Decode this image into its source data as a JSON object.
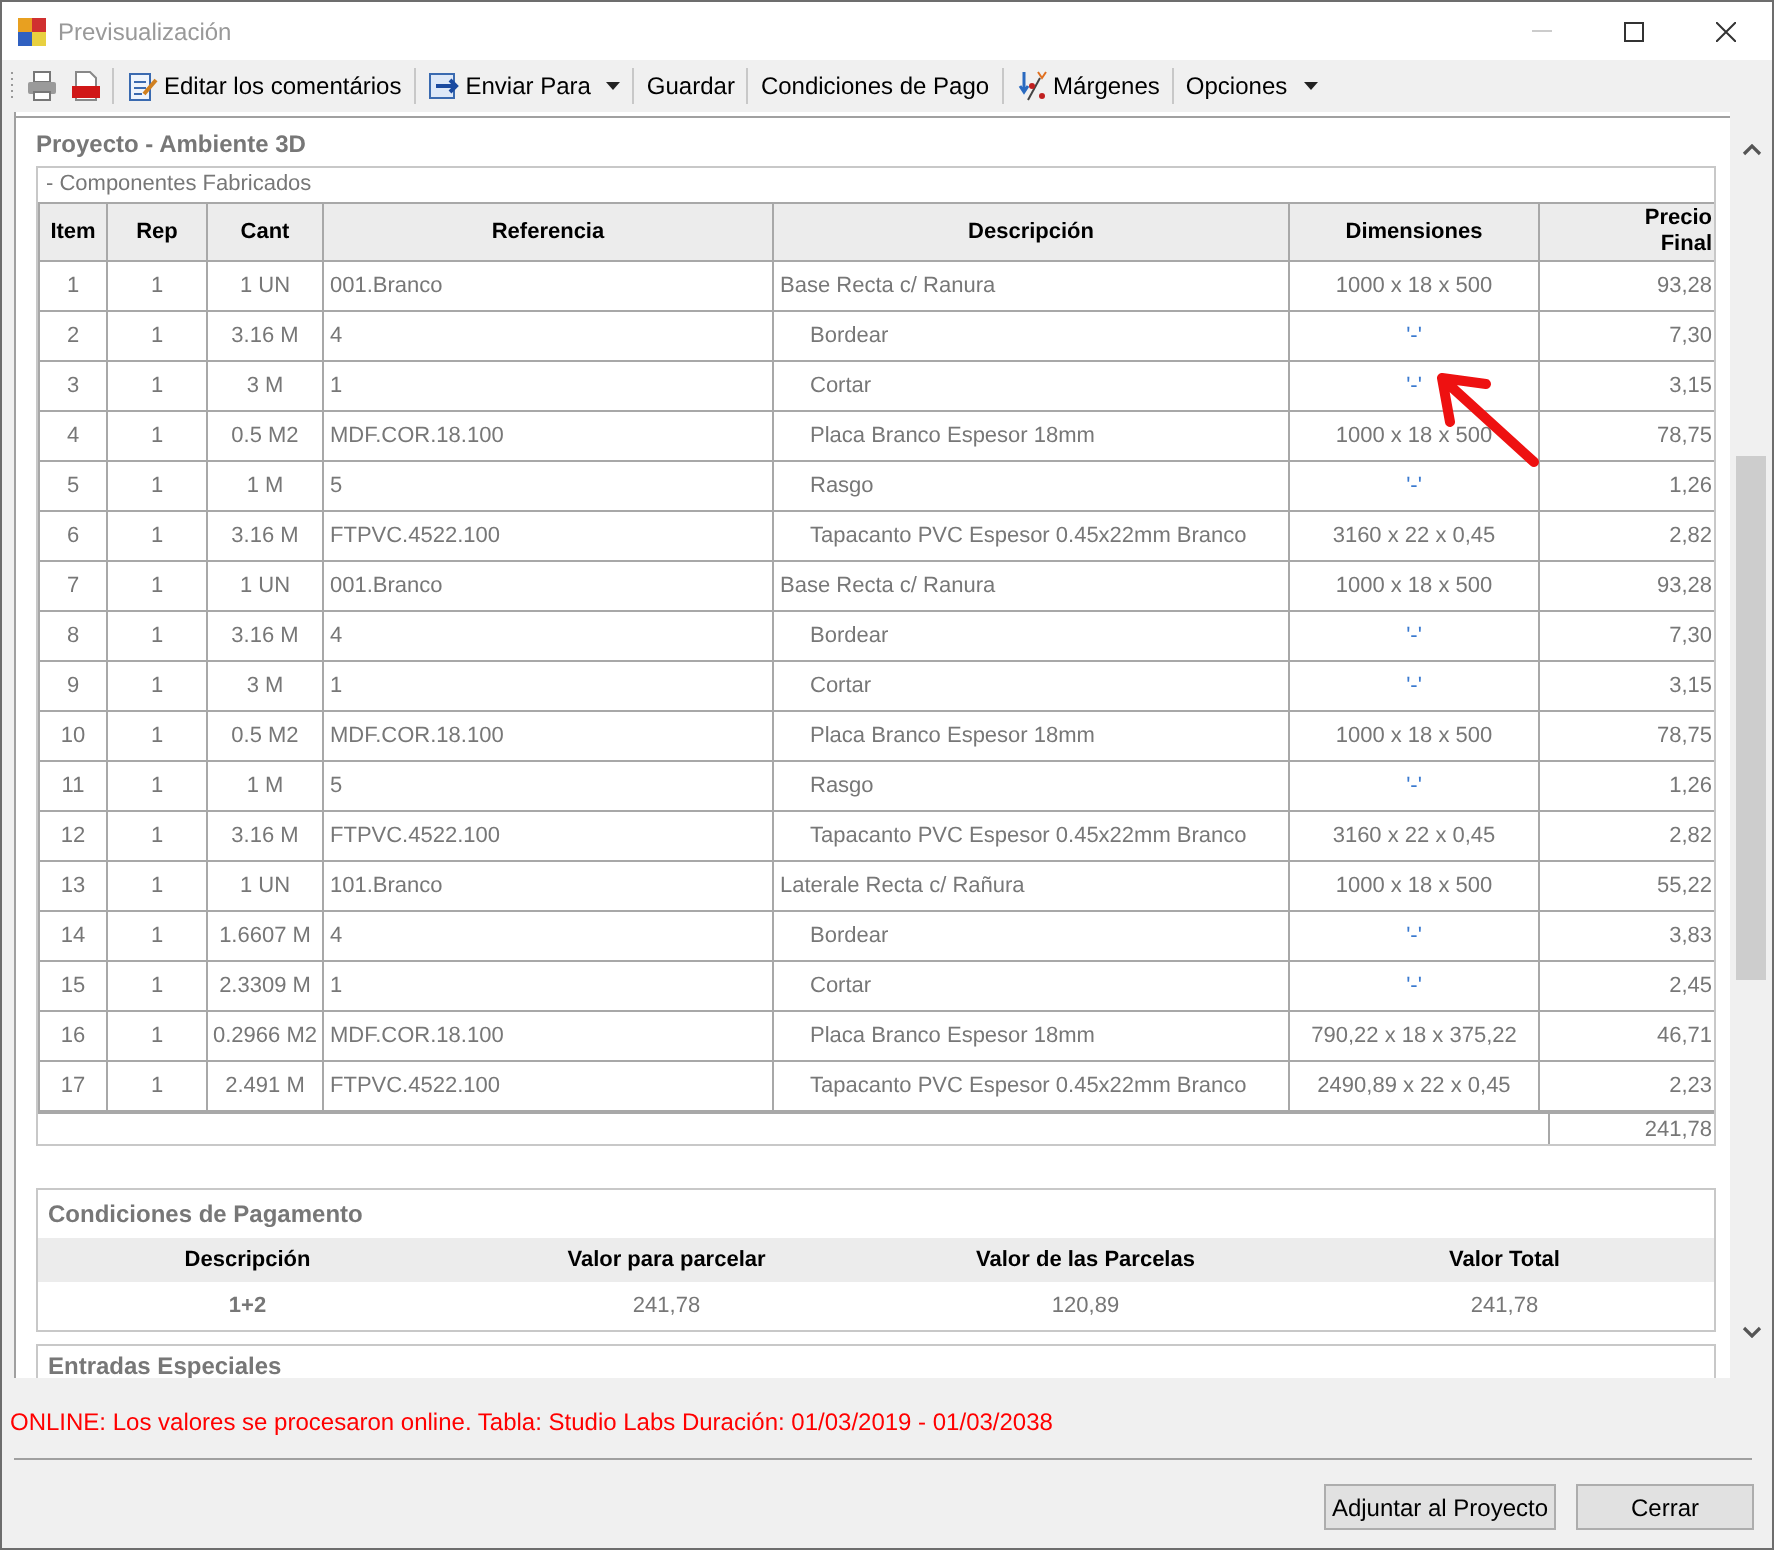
{
  "window": {
    "title": "Previsualización"
  },
  "toolbar": [
    {
      "kind": "icon"
    },
    {
      "kind": "icon"
    },
    {
      "kind": "sep"
    },
    {
      "kind": "button",
      "label": "Editar los comentários"
    },
    {
      "kind": "sep"
    },
    {
      "kind": "dropdown",
      "label": "Enviar Para"
    },
    {
      "kind": "sep"
    },
    {
      "kind": "button",
      "label": "Guardar"
    },
    {
      "kind": "sep"
    },
    {
      "kind": "button",
      "label": "Condiciones de Pago"
    },
    {
      "kind": "sep"
    },
    {
      "kind": "button",
      "label": "Márgenes"
    },
    {
      "kind": "sep"
    },
    {
      "kind": "dropdown",
      "label": "Opciones"
    }
  ],
  "report": {
    "title": "Proyecto - Ambiente 3D",
    "section": "- Componentes Fabricados",
    "columns": [
      "Item",
      "Rep",
      "Cant",
      "Referencia",
      "Descripción",
      "Dimensiones",
      "Precio Final"
    ],
    "rows": [
      {
        "kind": "component",
        "cells": [
          "1",
          "1",
          "1 UN",
          "001.Branco",
          "Base Recta c/ Ranura",
          "1000 x 18 x 500",
          "93,28"
        ]
      },
      {
        "kind": "part",
        "cells": [
          "2",
          "1",
          "3.16 M",
          "4",
          "Bordear",
          "'-'",
          "7,30"
        ]
      },
      {
        "kind": "part",
        "cells": [
          "3",
          "1",
          "3 M",
          "1",
          "Cortar",
          "'-'",
          "3,15"
        ]
      },
      {
        "kind": "part",
        "cells": [
          "4",
          "1",
          "0.5 M2",
          "MDF.COR.18.100",
          "Placa Branco Espesor 18mm",
          "1000 x 18 x 500",
          "78,75"
        ]
      },
      {
        "kind": "part",
        "cells": [
          "5",
          "1",
          "1 M",
          "5",
          "Rasgo",
          "'-'",
          "1,26"
        ]
      },
      {
        "kind": "part",
        "cells": [
          "6",
          "1",
          "3.16 M",
          "FTPVC.4522.100",
          "Tapacanto PVC Espesor 0.45x22mm Branco",
          "3160 x 22 x 0,45",
          "2,82"
        ]
      },
      {
        "kind": "component",
        "cells": [
          "7",
          "1",
          "1 UN",
          "001.Branco",
          "Base Recta c/ Ranura",
          "1000 x 18 x 500",
          "93,28"
        ]
      },
      {
        "kind": "part",
        "cells": [
          "8",
          "1",
          "3.16 M",
          "4",
          "Bordear",
          "'-'",
          "7,30"
        ]
      },
      {
        "kind": "part",
        "cells": [
          "9",
          "1",
          "3 M",
          "1",
          "Cortar",
          "'-'",
          "3,15"
        ]
      },
      {
        "kind": "part",
        "cells": [
          "10",
          "1",
          "0.5 M2",
          "MDF.COR.18.100",
          "Placa Branco Espesor 18mm",
          "1000 x 18 x 500",
          "78,75"
        ]
      },
      {
        "kind": "part",
        "cells": [
          "11",
          "1",
          "1 M",
          "5",
          "Rasgo",
          "'-'",
          "1,26"
        ]
      },
      {
        "kind": "part",
        "cells": [
          "12",
          "1",
          "3.16 M",
          "FTPVC.4522.100",
          "Tapacanto PVC Espesor 0.45x22mm Branco",
          "3160 x 22 x 0,45",
          "2,82"
        ]
      },
      {
        "kind": "component",
        "cells": [
          "13",
          "1",
          "1 UN",
          "101.Branco",
          "Laterale Recta c/ Rañura",
          "1000 x 18 x 500",
          "55,22"
        ]
      },
      {
        "kind": "part",
        "cells": [
          "14",
          "1",
          "1.6607 M",
          "4",
          "Bordear",
          "'-'",
          "3,83"
        ]
      },
      {
        "kind": "part",
        "cells": [
          "15",
          "1",
          "2.3309 M",
          "1",
          "Cortar",
          "'-'",
          "2,45"
        ]
      },
      {
        "kind": "part",
        "cells": [
          "16",
          "1",
          "0.2966 M2",
          "MDF.COR.18.100",
          "Placa Branco Espesor 18mm",
          "790,22 x 18 x 375,22",
          "46,71"
        ]
      },
      {
        "kind": "part",
        "cells": [
          "17",
          "1",
          "2.491 M",
          "FTPVC.4522.100",
          "Tapacanto PVC Espesor 0.45x22mm Branco",
          "2490,89 x 22 x 0,45",
          "2,23"
        ]
      }
    ],
    "total": "241,78"
  },
  "payment": {
    "title": "Condiciones de Pagamento",
    "columns": [
      "Descripción",
      "Valor para parcelar",
      "Valor de las Parcelas",
      "Valor Total"
    ],
    "rows": [
      [
        "1+2",
        "241,78",
        "120,89",
        "241,78"
      ]
    ]
  },
  "next_section": {
    "title": "Entradas Especiales"
  },
  "status": "ONLINE: Los valores se procesaron online. Tabla: Studio Labs Duración: 01/03/2019 - 01/03/2038",
  "buttons": [
    "Adjuntar al Proyecto",
    "Cerrar"
  ]
}
